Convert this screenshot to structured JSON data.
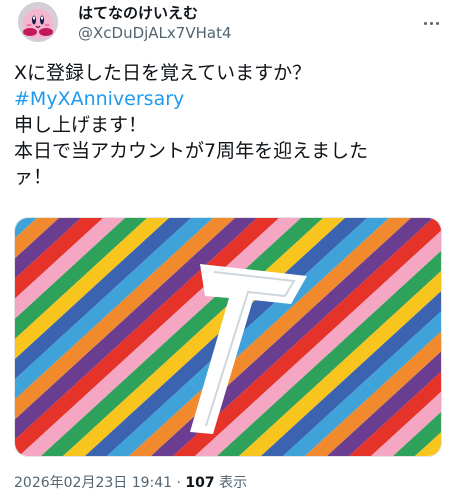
{
  "author": {
    "display_name": "はてなのけいえむ",
    "handle": "@XcDuDjALx7VHat4",
    "avatar_icon": "kirby-avatar-icon"
  },
  "tweet": {
    "lines": [
      "Xに登録した日を覚えていますか？",
      "#MyXAnniversary",
      "申し上げます！",
      "本日で当アカウントが7周年を迎えました",
      "ァ！"
    ],
    "image_numeral": "7"
  },
  "meta": {
    "datetime": "2026年02月23日 19:41",
    "separator": " · ",
    "views_count": "107",
    "views_label": " 表示"
  },
  "colors": {
    "hashtag": "#1d9bf0",
    "secondary_text": "#536471",
    "stripes": [
      "#3fa2d9",
      "#f08a2c",
      "#6b3d91",
      "#e5332a",
      "#f4a6c2",
      "#2ea15a",
      "#f7c51e",
      "#3c63b0"
    ]
  }
}
